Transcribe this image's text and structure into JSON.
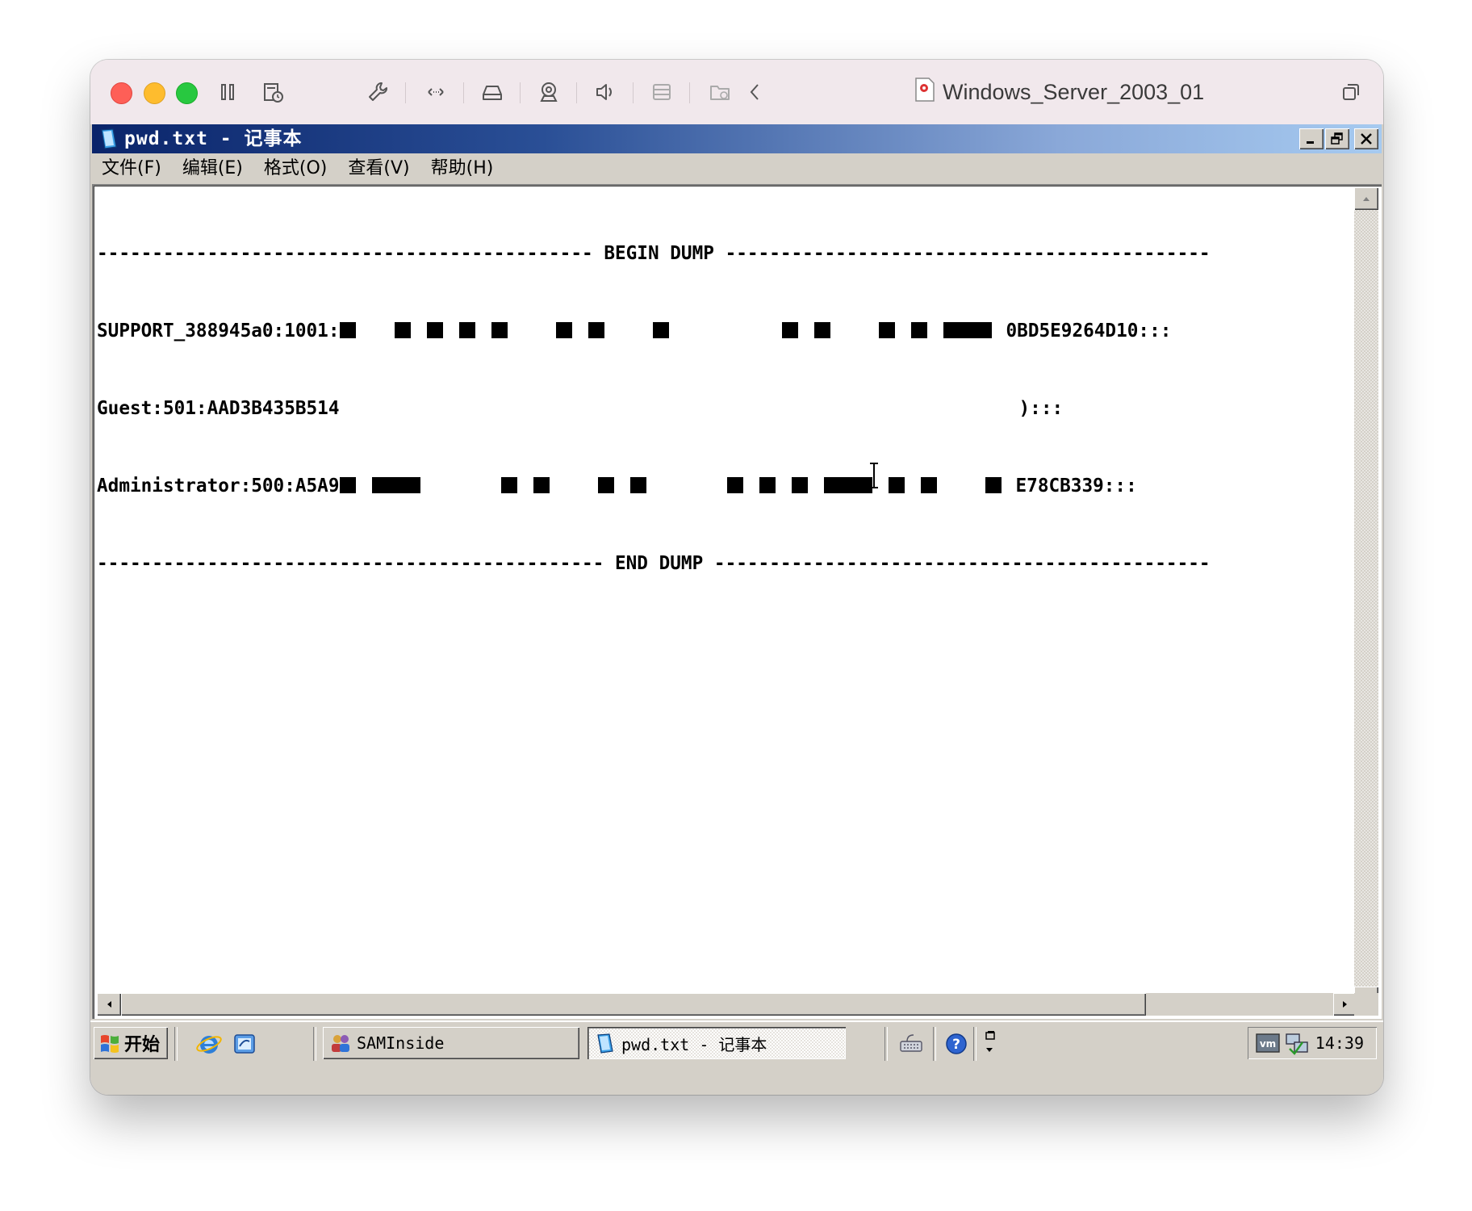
{
  "mac_window": {
    "title": "Windows_Server_2003_01",
    "toolbar_icons": [
      "pause-icon",
      "snapshot-icon",
      "settings-wrench-icon",
      "network-arrows-icon",
      "disk-drive-icon",
      "webcam-icon",
      "sound-icon",
      "display-icon",
      "shared-folder-icon",
      "back-chevron-icon",
      "duplicate-icon"
    ]
  },
  "notepad": {
    "title": "pwd.txt - 记事本",
    "menu": {
      "file": "文件(F)",
      "edit": "编辑(E)",
      "format": "格式(O)",
      "view": "查看(V)",
      "help": "帮助(H)"
    },
    "content": {
      "begin_line": "--------------------------------------------- BEGIN DUMP --------------------------------------------",
      "support_prefix": "SUPPORT_388945a0:1001:",
      "support_suffix": "0BD5E9264D10:::",
      "guest_prefix": "Guest:501:AAD3B435B514",
      "guest_suffix": "):::",
      "admin_prefix": "Administrator:500:A5A9",
      "admin_suffix": "E78CB339:::",
      "end_line": "---------------------------------------------- END DUMP ---------------------------------------------"
    }
  },
  "taskbar": {
    "start_label": "开始",
    "tasks": [
      {
        "label": "SAMInside",
        "active": false
      },
      {
        "label": "pwd.txt - 记事本",
        "active": true
      }
    ],
    "clock": "14:39"
  },
  "colors": {
    "titlebar_active": "#0a246a",
    "titlebar_gradient_end": "#a6caf0",
    "win_face": "#d4d0c8",
    "mac_titlebar": "#f1e8ec"
  }
}
